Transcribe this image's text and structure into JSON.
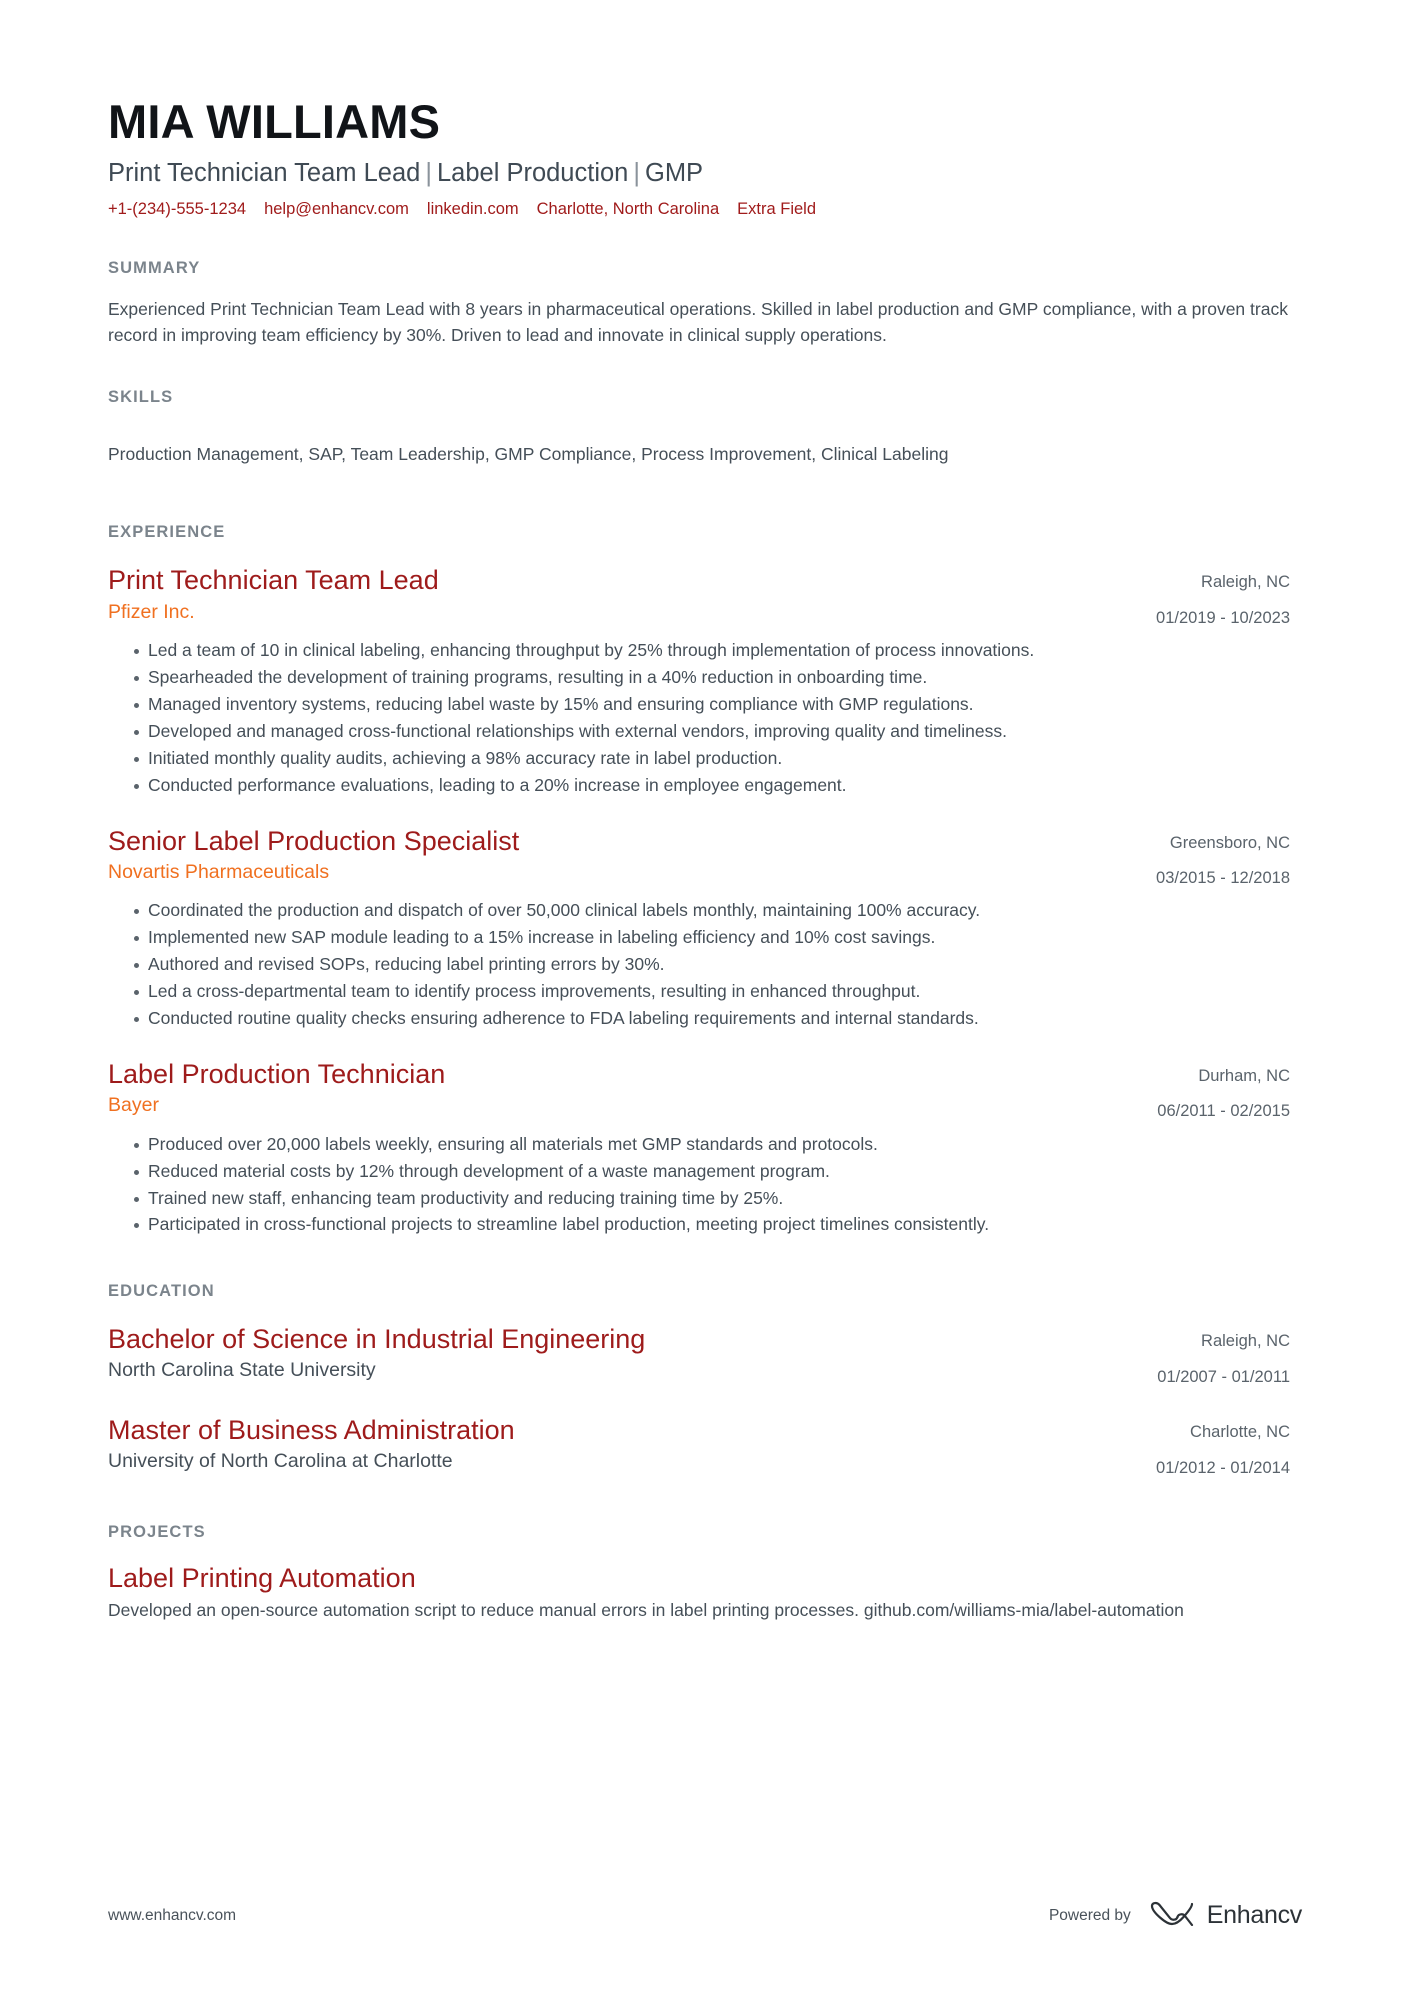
{
  "header": {
    "name": "MIA WILLIAMS",
    "headline_parts": [
      "Print Technician Team Lead",
      "Label Production",
      "GMP"
    ],
    "headline_separator": "|",
    "contact": [
      {
        "name": "phone",
        "value": "+1-(234)-555-1234"
      },
      {
        "name": "email",
        "value": "help@enhancv.com"
      },
      {
        "name": "linkedin",
        "value": "linkedin.com"
      },
      {
        "name": "location",
        "value": "Charlotte, North Carolina"
      },
      {
        "name": "extra",
        "value": "Extra Field"
      }
    ]
  },
  "summary": {
    "title": "SUMMARY",
    "text": "Experienced Print Technician Team Lead with 8 years in pharmaceutical operations. Skilled in label production and GMP compliance, with a proven track record in improving team efficiency by 30%. Driven to lead and innovate in clinical supply operations."
  },
  "skills": {
    "title": "SKILLS",
    "text": "Production Management, SAP, Team Leadership, GMP Compliance, Process Improvement, Clinical Labeling",
    "items": [
      "Production Management",
      "SAP",
      "Team Leadership",
      "GMP Compliance",
      "Process Improvement",
      "Clinical Labeling"
    ]
  },
  "experience": {
    "title": "EXPERIENCE",
    "entries": [
      {
        "title": "Print Technician Team Lead",
        "company": "Pfizer Inc.",
        "location": "Raleigh, NC",
        "dates": "01/2019 - 10/2023",
        "bullets": [
          "Led a team of 10 in clinical labeling, enhancing throughput by 25% through implementation of process innovations.",
          "Spearheaded the development of training programs, resulting in a 40% reduction in onboarding time.",
          "Managed inventory systems, reducing label waste by 15% and ensuring compliance with GMP regulations.",
          "Developed and managed cross-functional relationships with external vendors, improving quality and timeliness.",
          "Initiated monthly quality audits, achieving a 98% accuracy rate in label production.",
          "Conducted performance evaluations, leading to a 20% increase in employee engagement."
        ]
      },
      {
        "title": "Senior Label Production Specialist",
        "company": "Novartis Pharmaceuticals",
        "location": "Greensboro, NC",
        "dates": "03/2015 - 12/2018",
        "bullets": [
          "Coordinated the production and dispatch of over 50,000 clinical labels monthly, maintaining 100% accuracy.",
          "Implemented new SAP module leading to a 15% increase in labeling efficiency and 10% cost savings.",
          "Authored and revised SOPs, reducing label printing errors by 30%.",
          "Led a cross-departmental team to identify process improvements, resulting in enhanced throughput.",
          "Conducted routine quality checks ensuring adherence to FDA labeling requirements and internal standards."
        ]
      },
      {
        "title": "Label Production Technician",
        "company": "Bayer",
        "location": "Durham, NC",
        "dates": "06/2011 - 02/2015",
        "bullets": [
          "Produced over 20,000 labels weekly, ensuring all materials met GMP standards and protocols.",
          "Reduced material costs by 12% through development of a waste management program.",
          "Trained new staff, enhancing team productivity and reducing training time by 25%.",
          "Participated in cross-functional projects to streamline label production, meeting project timelines consistently."
        ]
      }
    ]
  },
  "education": {
    "title": "EDUCATION",
    "entries": [
      {
        "degree": "Bachelor of Science in Industrial Engineering",
        "school": "North Carolina State University",
        "location": "Raleigh, NC",
        "dates": "01/2007 - 01/2011"
      },
      {
        "degree": "Master of Business Administration",
        "school": "University of North Carolina at Charlotte",
        "location": "Charlotte, NC",
        "dates": "01/2012 - 01/2014"
      }
    ]
  },
  "projects": {
    "title": "PROJECTS",
    "entries": [
      {
        "name": "Label Printing Automation",
        "description": "Developed an open-source automation script to reduce manual errors in label printing processes. github.com/williams-mia/label-automation"
      }
    ]
  },
  "footer": {
    "url": "www.enhancv.com",
    "powered_by": "Powered by",
    "brand": "Enhancv"
  },
  "colors": {
    "accent_red": "#9e1b1b",
    "contact_red": "#a01b1b",
    "company_orange": "#f07020",
    "section_gray": "#7b848c",
    "body_gray": "#454f58"
  }
}
